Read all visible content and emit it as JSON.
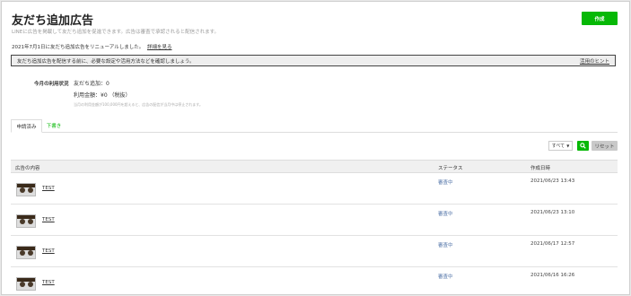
{
  "header": {
    "title": "友だち追加広告",
    "subtitle": "LINEに広告を掲載して友だち追加を促進できます。広告は審査で承認されると配信されます。",
    "create_button": "作成"
  },
  "notice": {
    "text": "2021年7月1日に友だち追加広告をリニューアルしました。",
    "link": "詳細を見る"
  },
  "tip_bar": {
    "text": "友だち追加広告を配信する前に、必要な設定や活用方法などを確認しましょう。",
    "link": "活用のヒント"
  },
  "usage": {
    "label": "今月の利用状況",
    "friends": "友だち追加：0",
    "amount": "利用金額：¥0 （税抜）",
    "note": "当月の利用金額が100,000円を超えると、広告の配信が当月中は停止されます。"
  },
  "tabs": [
    {
      "label": "申請済み"
    },
    {
      "label": "下書き"
    }
  ],
  "filters": {
    "select_value": "すべて",
    "reset_button": "リセット"
  },
  "table": {
    "columns": [
      "広告の内容",
      "ステータス",
      "作成日時"
    ],
    "rows": [
      {
        "name": "TEST",
        "status": "審査中",
        "date": "2021/06/23 13:43"
      },
      {
        "name": "TEST",
        "status": "審査中",
        "date": "2021/06/23 13:10"
      },
      {
        "name": "TEST",
        "status": "審査中",
        "date": "2021/06/17 12:57"
      },
      {
        "name": "TEST",
        "status": "審査中",
        "date": "2021/06/16 16:26"
      }
    ]
  },
  "colors": {
    "accent": "#06b806",
    "status": "#5577aa"
  }
}
